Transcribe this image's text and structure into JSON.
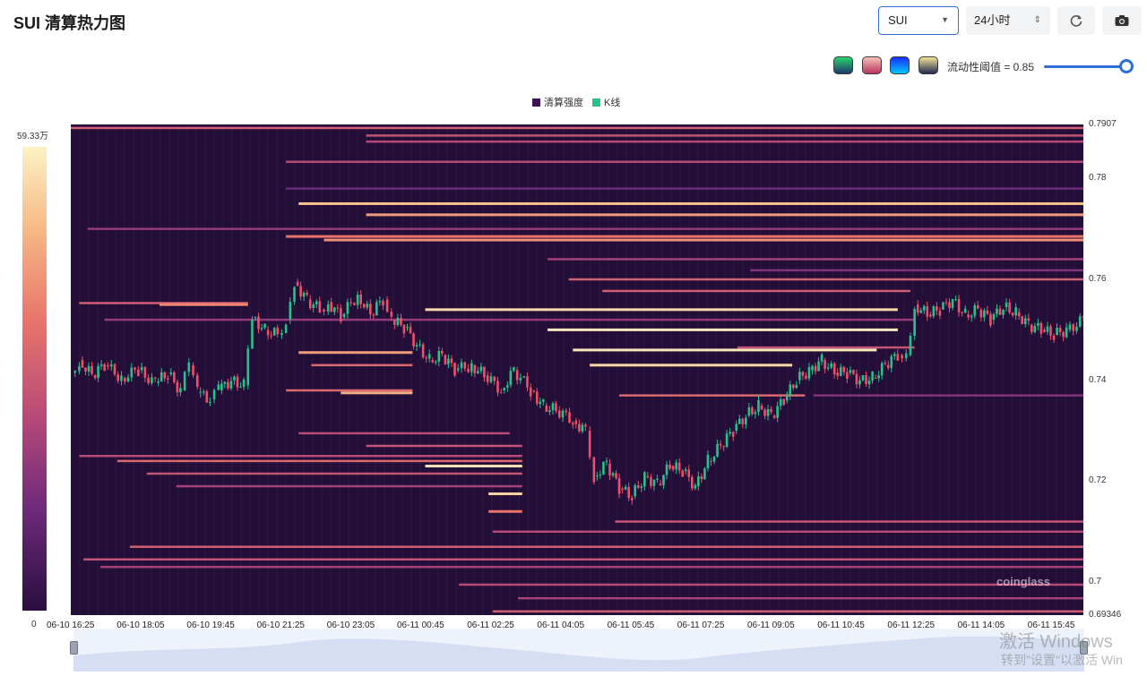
{
  "header": {
    "title": "SUI 清算热力图",
    "coin_select": "SUI",
    "range_select": "24小时",
    "refresh_icon": "refresh-icon",
    "camera_icon": "camera-icon"
  },
  "toolbar": {
    "palettes": [
      {
        "name": "palette-green",
        "colors": [
          "#2bd36b",
          "#1a3a6a"
        ]
      },
      {
        "name": "palette-pink",
        "colors": [
          "#f7c1b8",
          "#b8355e"
        ]
      },
      {
        "name": "palette-blue",
        "colors": [
          "#1a2cff",
          "#00c7ff"
        ]
      },
      {
        "name": "palette-gray",
        "colors": [
          "#f2e49a",
          "#232a4f"
        ]
      }
    ],
    "threshold_label": "流动性阈值 = 0.85",
    "threshold_value": 0.85
  },
  "legend": {
    "items": [
      {
        "label": "清算强度",
        "color": "#3b1452"
      },
      {
        "label": "K线",
        "color": "#27c28c"
      }
    ]
  },
  "colorbar": {
    "max_label": "59.33万",
    "min_label": "0"
  },
  "chart_data": {
    "type": "heatmap",
    "title": "",
    "background": "#230e37",
    "ylim": [
      0.69346,
      0.7907
    ],
    "y_ticks": [
      "0.7907",
      "0.78",
      "0.76",
      "0.74",
      "0.72",
      "0.7",
      "0.69346"
    ],
    "y_tick_values": [
      0.7907,
      0.78,
      0.76,
      0.74,
      0.72,
      0.7,
      0.69346
    ],
    "x_ticks": [
      "06-10 16:25",
      "06-10 18:05",
      "06-10 19:45",
      "06-10 21:25",
      "06-10 23:05",
      "06-11 00:45",
      "06-11 02:25",
      "06-11 04:05",
      "06-11 05:45",
      "06-11 07:25",
      "06-11 09:05",
      "06-11 10:45",
      "06-11 12:25",
      "06-11 14:05",
      "06-11 15:45"
    ],
    "x_range_hours": [
      0,
      24
    ],
    "liquidation_bands": [
      {
        "price": 0.79,
        "start_h": 0.0,
        "end_h": 24.0,
        "intensity": 0.55
      },
      {
        "price": 0.7885,
        "start_h": 7.0,
        "end_h": 24.0,
        "intensity": 0.5
      },
      {
        "price": 0.7873,
        "start_h": 7.0,
        "end_h": 24.0,
        "intensity": 0.45
      },
      {
        "price": 0.7833,
        "start_h": 5.1,
        "end_h": 24.0,
        "intensity": 0.45
      },
      {
        "price": 0.778,
        "start_h": 5.1,
        "end_h": 24.0,
        "intensity": 0.25
      },
      {
        "price": 0.775,
        "start_h": 5.4,
        "end_h": 24.0,
        "intensity": 0.85
      },
      {
        "price": 0.7728,
        "start_h": 7.0,
        "end_h": 24.0,
        "intensity": 0.75
      },
      {
        "price": 0.77,
        "start_h": 0.4,
        "end_h": 24.0,
        "intensity": 0.35
      },
      {
        "price": 0.7685,
        "start_h": 5.1,
        "end_h": 24.0,
        "intensity": 0.65
      },
      {
        "price": 0.7678,
        "start_h": 6.0,
        "end_h": 24.0,
        "intensity": 0.72
      },
      {
        "price": 0.764,
        "start_h": 11.3,
        "end_h": 24.0,
        "intensity": 0.4
      },
      {
        "price": 0.7618,
        "start_h": 16.1,
        "end_h": 24.0,
        "intensity": 0.3
      },
      {
        "price": 0.76,
        "start_h": 11.8,
        "end_h": 24.0,
        "intensity": 0.55
      },
      {
        "price": 0.7577,
        "start_h": 12.6,
        "end_h": 19.9,
        "intensity": 0.55
      },
      {
        "price": 0.7553,
        "start_h": 0.2,
        "end_h": 4.2,
        "intensity": 0.55
      },
      {
        "price": 0.755,
        "start_h": 2.1,
        "end_h": 4.2,
        "intensity": 0.7
      },
      {
        "price": 0.754,
        "start_h": 8.4,
        "end_h": 19.6,
        "intensity": 0.92
      },
      {
        "price": 0.752,
        "start_h": 0.8,
        "end_h": 20.0,
        "intensity": 0.35
      },
      {
        "price": 0.75,
        "start_h": 13.0,
        "end_h": 19.6,
        "intensity": 0.6
      },
      {
        "price": 0.75,
        "start_h": 11.3,
        "end_h": 19.6,
        "intensity": 0.97
      },
      {
        "price": 0.7465,
        "start_h": 15.8,
        "end_h": 20.0,
        "intensity": 0.5
      },
      {
        "price": 0.746,
        "start_h": 11.9,
        "end_h": 19.1,
        "intensity": 0.97
      },
      {
        "price": 0.7455,
        "start_h": 5.4,
        "end_h": 8.1,
        "intensity": 0.75
      },
      {
        "price": 0.743,
        "start_h": 5.7,
        "end_h": 8.1,
        "intensity": 0.6
      },
      {
        "price": 0.743,
        "start_h": 12.3,
        "end_h": 17.1,
        "intensity": 0.92
      },
      {
        "price": 0.738,
        "start_h": 5.1,
        "end_h": 8.1,
        "intensity": 0.6
      },
      {
        "price": 0.7375,
        "start_h": 6.4,
        "end_h": 8.1,
        "intensity": 0.8
      },
      {
        "price": 0.737,
        "start_h": 13.0,
        "end_h": 17.4,
        "intensity": 0.6
      },
      {
        "price": 0.737,
        "start_h": 17.6,
        "end_h": 24.0,
        "intensity": 0.3
      },
      {
        "price": 0.7295,
        "start_h": 5.4,
        "end_h": 10.4,
        "intensity": 0.45
      },
      {
        "price": 0.727,
        "start_h": 7.0,
        "end_h": 10.7,
        "intensity": 0.5
      },
      {
        "price": 0.725,
        "start_h": 0.2,
        "end_h": 10.7,
        "intensity": 0.45
      },
      {
        "price": 0.724,
        "start_h": 1.1,
        "end_h": 10.7,
        "intensity": 0.6
      },
      {
        "price": 0.723,
        "start_h": 8.4,
        "end_h": 10.7,
        "intensity": 0.95
      },
      {
        "price": 0.7215,
        "start_h": 1.8,
        "end_h": 10.7,
        "intensity": 0.5
      },
      {
        "price": 0.719,
        "start_h": 2.5,
        "end_h": 10.7,
        "intensity": 0.4
      },
      {
        "price": 0.7175,
        "start_h": 9.9,
        "end_h": 10.7,
        "intensity": 0.9
      },
      {
        "price": 0.714,
        "start_h": 9.9,
        "end_h": 10.7,
        "intensity": 0.65
      },
      {
        "price": 0.712,
        "start_h": 12.9,
        "end_h": 24.0,
        "intensity": 0.5
      },
      {
        "price": 0.71,
        "start_h": 10.0,
        "end_h": 24.0,
        "intensity": 0.45
      },
      {
        "price": 0.707,
        "start_h": 1.4,
        "end_h": 24.0,
        "intensity": 0.55
      },
      {
        "price": 0.7045,
        "start_h": 0.3,
        "end_h": 24.0,
        "intensity": 0.5
      },
      {
        "price": 0.703,
        "start_h": 0.7,
        "end_h": 24.0,
        "intensity": 0.4
      },
      {
        "price": 0.6995,
        "start_h": 9.2,
        "end_h": 24.0,
        "intensity": 0.45
      },
      {
        "price": 0.6968,
        "start_h": 10.6,
        "end_h": 24.0,
        "intensity": 0.4
      },
      {
        "price": 0.6942,
        "start_h": 10.0,
        "end_h": 24.0,
        "intensity": 0.55
      }
    ],
    "price_path": [
      [
        0.0,
        0.7415
      ],
      [
        0.2,
        0.744
      ],
      [
        0.5,
        0.741
      ],
      [
        0.8,
        0.743
      ],
      [
        1.2,
        0.7405
      ],
      [
        1.6,
        0.742
      ],
      [
        2.0,
        0.7395
      ],
      [
        2.3,
        0.7412
      ],
      [
        2.6,
        0.738
      ],
      [
        2.8,
        0.743
      ],
      [
        3.0,
        0.7375
      ],
      [
        3.3,
        0.7362
      ],
      [
        3.5,
        0.738
      ],
      [
        3.8,
        0.74
      ],
      [
        4.1,
        0.739
      ],
      [
        4.3,
        0.7525
      ],
      [
        4.6,
        0.75
      ],
      [
        4.9,
        0.749
      ],
      [
        5.1,
        0.752
      ],
      [
        5.3,
        0.7595
      ],
      [
        5.6,
        0.756
      ],
      [
        5.9,
        0.754
      ],
      [
        6.1,
        0.7555
      ],
      [
        6.4,
        0.7525
      ],
      [
        6.8,
        0.757
      ],
      [
        7.1,
        0.753
      ],
      [
        7.4,
        0.756
      ],
      [
        7.6,
        0.752
      ],
      [
        7.9,
        0.7505
      ],
      [
        8.2,
        0.747
      ],
      [
        8.5,
        0.744
      ],
      [
        8.8,
        0.745
      ],
      [
        9.1,
        0.742
      ],
      [
        9.5,
        0.743
      ],
      [
        9.8,
        0.741
      ],
      [
        10.2,
        0.738
      ],
      [
        10.5,
        0.742
      ],
      [
        10.9,
        0.738
      ],
      [
        11.2,
        0.735
      ],
      [
        11.5,
        0.734
      ],
      [
        11.9,
        0.732
      ],
      [
        12.2,
        0.73
      ],
      [
        12.4,
        0.721
      ],
      [
        12.7,
        0.7235
      ],
      [
        13.0,
        0.7185
      ],
      [
        13.3,
        0.717
      ],
      [
        13.6,
        0.721
      ],
      [
        13.9,
        0.7195
      ],
      [
        14.2,
        0.723
      ],
      [
        14.5,
        0.722
      ],
      [
        14.8,
        0.719
      ],
      [
        15.1,
        0.724
      ],
      [
        15.4,
        0.727
      ],
      [
        15.7,
        0.73
      ],
      [
        16.0,
        0.733
      ],
      [
        16.3,
        0.735
      ],
      [
        16.6,
        0.733
      ],
      [
        16.9,
        0.736
      ],
      [
        17.2,
        0.74
      ],
      [
        17.5,
        0.742
      ],
      [
        17.8,
        0.744
      ],
      [
        18.1,
        0.7415
      ],
      [
        18.4,
        0.7415
      ],
      [
        18.7,
        0.74
      ],
      [
        19.0,
        0.7405
      ],
      [
        19.3,
        0.743
      ],
      [
        19.6,
        0.745
      ],
      [
        19.8,
        0.745
      ],
      [
        20.0,
        0.755
      ],
      [
        20.3,
        0.753
      ],
      [
        20.6,
        0.754
      ],
      [
        20.9,
        0.756
      ],
      [
        21.2,
        0.753
      ],
      [
        21.5,
        0.754
      ],
      [
        21.8,
        0.752
      ],
      [
        22.1,
        0.7545
      ],
      [
        22.4,
        0.7535
      ],
      [
        22.7,
        0.751
      ],
      [
        23.0,
        0.75
      ],
      [
        23.3,
        0.749
      ],
      [
        23.6,
        0.75
      ],
      [
        24.0,
        0.752
      ]
    ]
  },
  "watermark": "coinglass",
  "os_overlay": {
    "line1": "激活 Windows",
    "line2": "转到\"设置\"以激活 Win"
  }
}
